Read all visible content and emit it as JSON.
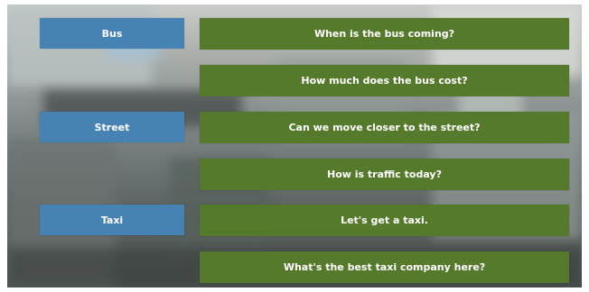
{
  "categories": [
    {
      "label": "Bus"
    },
    {
      "label": "Street"
    },
    {
      "label": "Taxi"
    }
  ],
  "phrases": [
    {
      "label": "When is the bus coming?"
    },
    {
      "label": "How much does the bus cost?"
    },
    {
      "label": "Can we move closer to the street?"
    },
    {
      "label": "How is traffic today?"
    },
    {
      "label": "Let's get a taxi."
    },
    {
      "label": "What's the best taxi company here?"
    }
  ],
  "colors": {
    "category_button": "#4683b4",
    "phrase_button": "#567a2c",
    "text": "#ffffff"
  }
}
